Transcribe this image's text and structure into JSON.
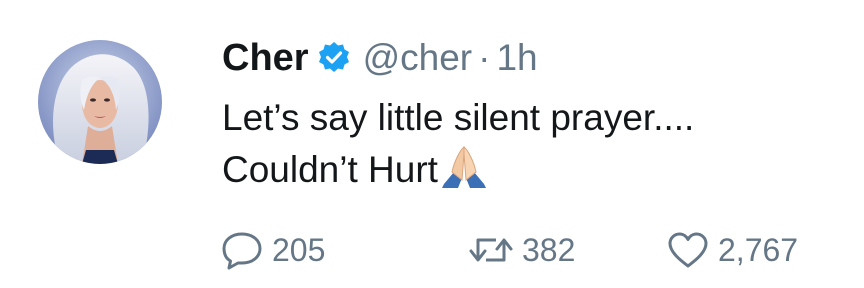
{
  "tweet": {
    "author": {
      "display_name": "Cher",
      "handle": "@cher",
      "verified": true,
      "avatar_icon": "avatar-photo"
    },
    "separator": "·",
    "timestamp": "1h",
    "text_lines": [
      "Let’s say little silent prayer....",
      "Couldn’t Hurt"
    ],
    "emoji": "folded-hands-icon",
    "actions": {
      "reply_count": "205",
      "retweet_count": "382",
      "like_count": "2,767"
    }
  },
  "colors": {
    "text_primary": "#14171a",
    "text_secondary": "#657786",
    "verified_blue": "#1da1f2"
  }
}
